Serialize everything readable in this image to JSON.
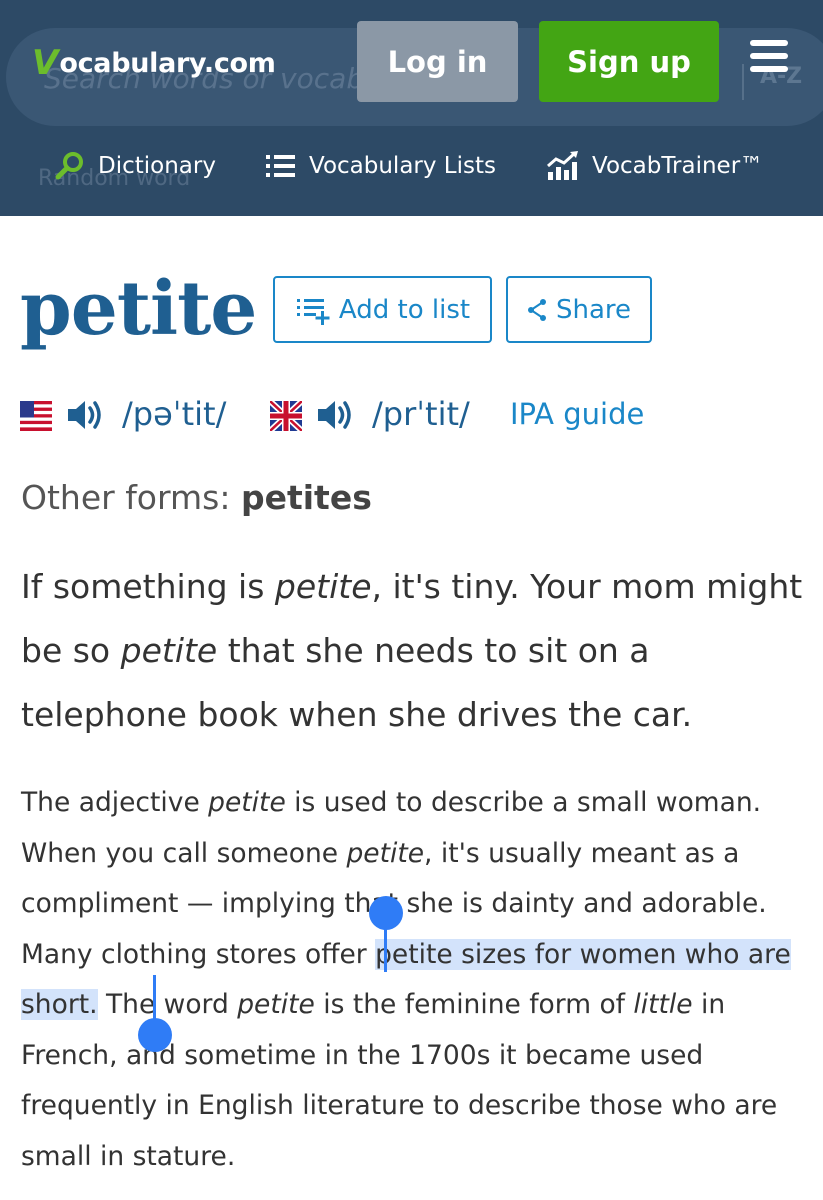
{
  "header": {
    "logo_v": "V",
    "logo_text": "ocabulary.com",
    "search_placeholder": "Search words or vocab",
    "random_word": "Random word",
    "az_badge": "A-Z",
    "login_label": "Log in",
    "signup_label": "Sign up",
    "nav": {
      "dictionary": "Dictionary",
      "lists": "Vocabulary Lists",
      "trainer": "VocabTrainer™"
    }
  },
  "word": {
    "title": "petite",
    "add_to_list": "Add to list",
    "share": "Share"
  },
  "pronunciation": {
    "us_ipa": "/pəˈtit/",
    "uk_ipa": "/prˈtit/",
    "guide_label": "IPA guide"
  },
  "other_forms": {
    "label": "Other forms:",
    "value": "petites"
  },
  "short_def": {
    "p1": "If something is ",
    "i1": "petite",
    "p2": ", it's tiny. Your mom might be so ",
    "i2": "petite",
    "p3": " that she needs to sit on a telephone book when she drives the car."
  },
  "long_def": {
    "p1": "The adjective ",
    "i1": "petite",
    "p2": " is used to describe a small woman. When you call someone ",
    "i2": "petite",
    "p3": ", it's usually meant as a compliment — implying that she is dainty and adorable. Many clothing stores offer ",
    "highlight": "petite sizes for women who are short.",
    "p4": " The word ",
    "i3": "petite",
    "p5": " is the feminine form of ",
    "i4": "little",
    "p6": " in French, and sometime in the 1700s it became used frequently in English literature to describe those who are small in stature."
  },
  "colors": {
    "header_bg": "#2d4a66",
    "brand_green": "#43a514",
    "link_blue": "#1a87c8",
    "title_blue": "#1f5f91",
    "selection": "#2f7cf6"
  }
}
